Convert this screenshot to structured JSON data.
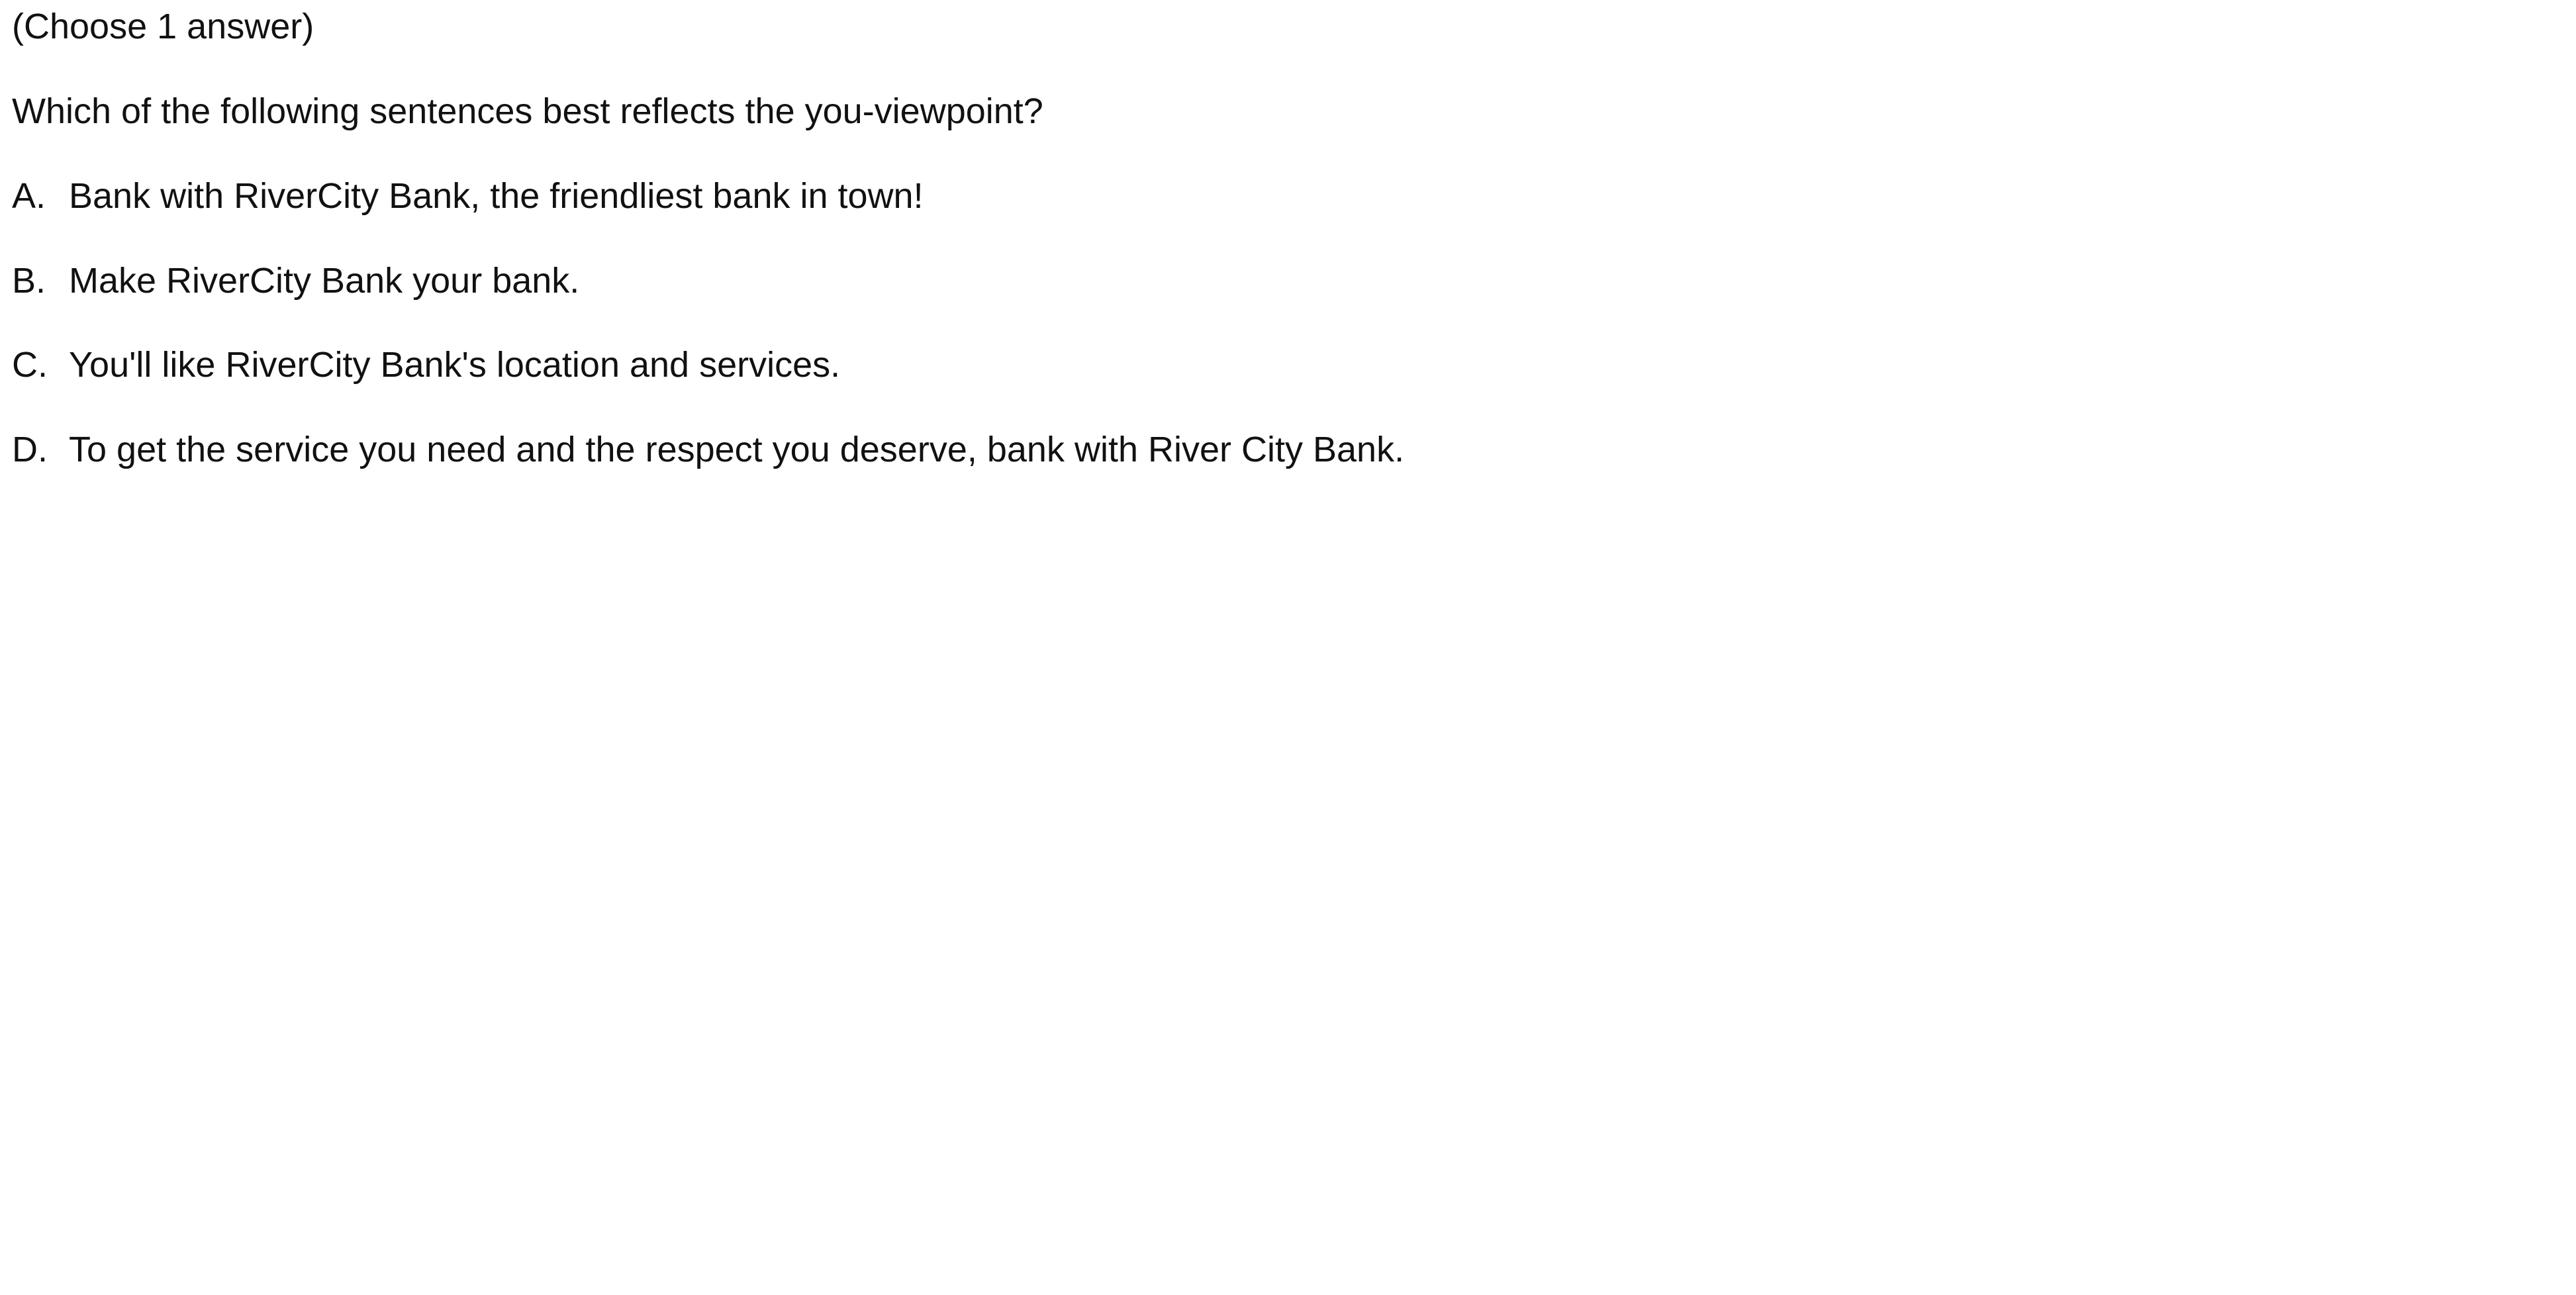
{
  "instruction": "(Choose 1 answer)",
  "question": "Which of the following sentences best reflects the you-viewpoint?",
  "options": [
    {
      "letter": "A.",
      "text": "Bank with RiverCity Bank, the friendliest bank in town!"
    },
    {
      "letter": "B.",
      "text": "Make RiverCity Bank your bank."
    },
    {
      "letter": "C.",
      "text": "You'll like RiverCity Bank's location and services."
    },
    {
      "letter": "D.",
      "text": "To get the service you need and the respect you deserve, bank with River City Bank."
    }
  ]
}
